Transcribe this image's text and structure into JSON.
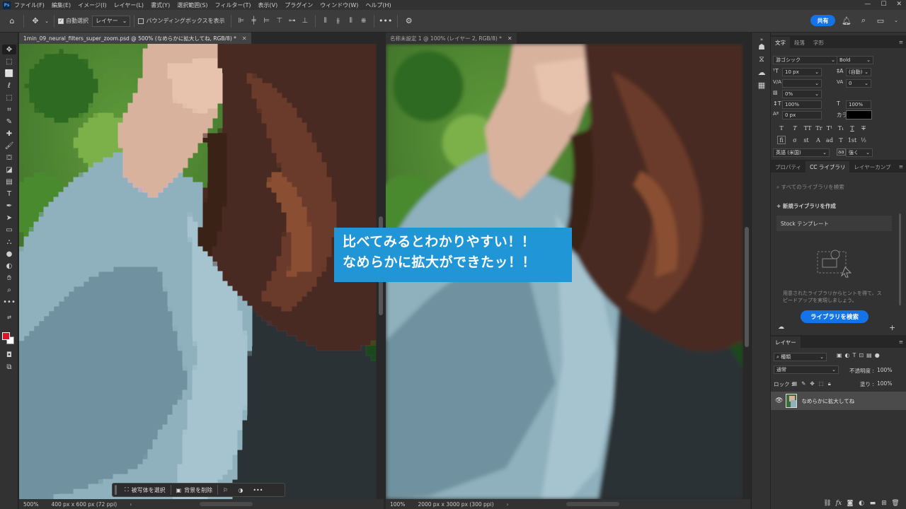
{
  "app": {
    "logo": "Ps",
    "menu": [
      "ファイル(F)",
      "編集(E)",
      "イメージ(I)",
      "レイヤー(L)",
      "書式(Y)",
      "選択範囲(S)",
      "フィルター(T)",
      "表示(V)",
      "プラグイン",
      "ウィンドウ(W)",
      "ヘルプ(H)"
    ],
    "window_controls": [
      "—",
      "☐",
      "✕"
    ]
  },
  "options_bar": {
    "auto_select_label": "自動選択",
    "layer_dropdown": "レイヤー",
    "bbox_label": "バウンディングボックスを表示",
    "more_label": "•••",
    "share_label": "共有"
  },
  "documents": [
    {
      "tab_title": "1min_09_neural_filters_super_zoom.psd @ 500% (なめらかに拡大してね, RGB/8) *",
      "zoom": "500%",
      "size_info": "400 px x 600 px (72 ppi)"
    },
    {
      "tab_title": "名称未設定 1 @ 100% (レイヤー 2, RGB/8) *",
      "zoom": "100%",
      "size_info": "2000 px x 3000 px (300 ppi)"
    }
  ],
  "caption": {
    "line1": "比べてみるとわかりやすい！！",
    "line2": "なめらかに拡大ができたッ！！"
  },
  "taskbar": {
    "select_subject": "被写体を選択",
    "remove_bg": "背景を削除",
    "more": "•••"
  },
  "character_panel": {
    "tabs": [
      "文字",
      "段落",
      "字形"
    ],
    "font_family": "游ゴシック",
    "font_style": "Bold",
    "font_size": "10 px",
    "leading": "(自動)",
    "kerning": "",
    "tracking": "0",
    "tsume": "0%",
    "vertical_scale": "100%",
    "horizontal_scale": "100%",
    "baseline": "0 px",
    "color_label": "カラー :",
    "text_color": "#000000",
    "language": "英語 (米国)",
    "antialias_symbol": "aa",
    "antialias": "強く",
    "style_buttons": [
      "T",
      "T",
      "TT",
      "Tr",
      "T¹",
      "T₁",
      "T",
      "T"
    ],
    "extra_buttons": [
      "ﬁ",
      "σ",
      "st",
      "A",
      "ad",
      "T",
      "1st",
      "½"
    ]
  },
  "library_panel": {
    "tabs": [
      "プロパティ",
      "CC ライブラリ",
      "レイヤーカンプ"
    ],
    "search_placeholder": "すべてのライブラリを検索",
    "new_library": "新規ライブラリを作成",
    "stock_templates": "Stock テンプレート",
    "hint_line1": "用意されたライブラリからヒントを得て、ス",
    "hint_line2": "ピードアップを実現しましょう。",
    "search_button": "ライブラリを検索"
  },
  "layers_panel": {
    "tab": "レイヤー",
    "filter_label": "種類",
    "blend_mode": "通常",
    "opacity_label": "不透明度 :",
    "opacity": "100%",
    "lock_label": "ロック :",
    "fill_label": "塗り :",
    "fill": "100%",
    "layer_name": "なめらかに拡大してね"
  }
}
